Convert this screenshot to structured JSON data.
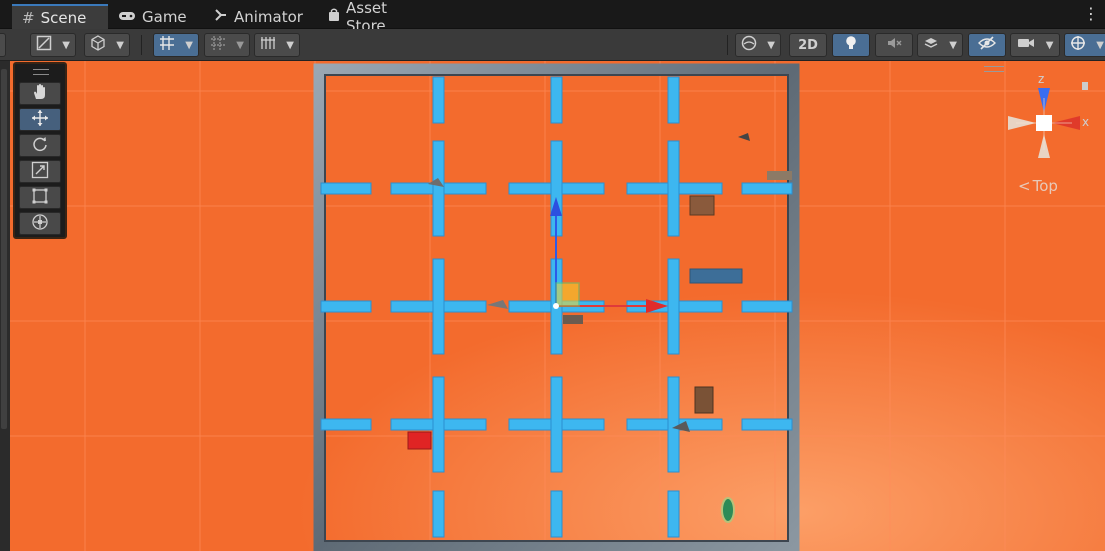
{
  "tabs": [
    {
      "label": "Scene",
      "icon": "hash-icon",
      "active": true
    },
    {
      "label": "Game",
      "icon": "gamepad-icon"
    },
    {
      "label": "Animator",
      "icon": "animator-icon"
    },
    {
      "label": "Asset Store",
      "icon": "bag-icon"
    }
  ],
  "toolbar": {
    "btn_2d": "2D"
  },
  "tools": [
    "hand-tool",
    "move-tool",
    "rotate-tool",
    "scale-tool",
    "rect-tool",
    "transform-tool"
  ],
  "gizmo": {
    "axis_x": "x",
    "axis_z": "z",
    "view_label": "Top"
  },
  "colors": {
    "ground": "#f36b2d",
    "wall": "#3db7f0",
    "selected_tab": "#3a79bb",
    "active_tool": "#46607d"
  }
}
